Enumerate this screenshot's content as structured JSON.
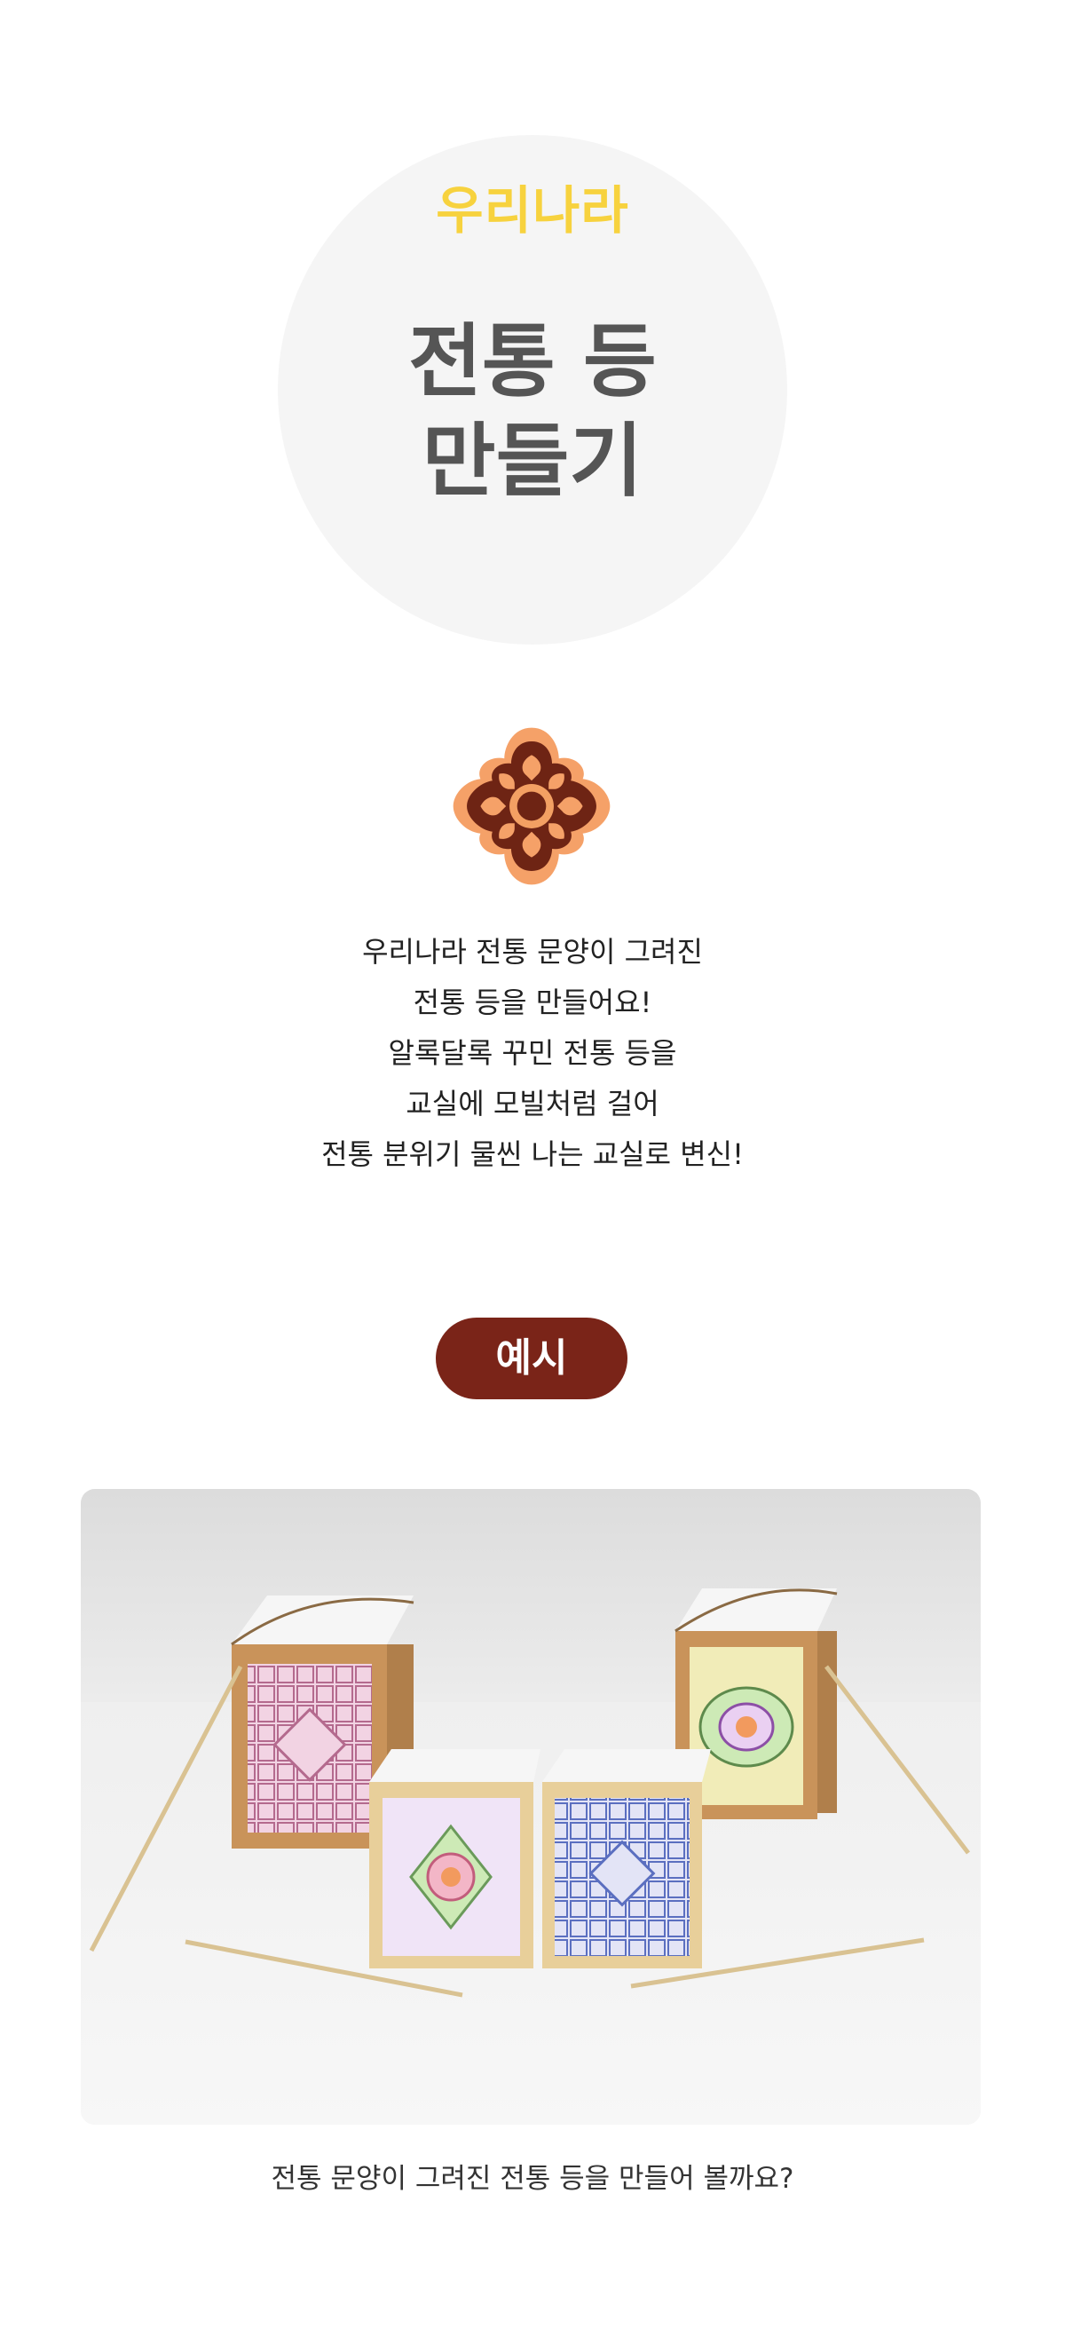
{
  "header": {
    "kicker": "우리나라",
    "title_line1": "전통 등",
    "title_line2": "만들기"
  },
  "ornament": {
    "icon": "traditional-flower-pattern-icon",
    "colors": {
      "outer": "#f5a168",
      "inner": "#6e2414",
      "center": "#f3a063"
    }
  },
  "description": {
    "lines": [
      "우리나라 전통 문양이 그려진",
      "전통 등을 만들어요!",
      "알록달록 꾸민 전통 등을",
      "교실에 모빌처럼 걸어",
      "전통 분위기 물씬 나는 교실로 변신!"
    ]
  },
  "example": {
    "badge_label": "예시",
    "badge_color": "#7a2418",
    "photo": "four-paper-lanterns-photo"
  },
  "caption": "전통 문양이 그려진 전통 등을 만들어 볼까요?",
  "colors": {
    "kicker": "#f7d23e",
    "title": "#555555",
    "circle_bg": "#f5f5f5"
  }
}
